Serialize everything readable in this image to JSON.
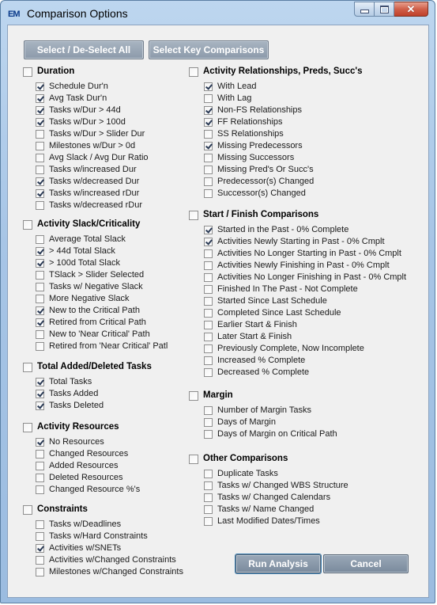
{
  "window": {
    "title": "Comparison Options",
    "icon_text": "EM"
  },
  "top_buttons": {
    "select_all": "Select / De-Select All",
    "select_key": "Select Key Comparisons"
  },
  "bottom_buttons": {
    "run": "Run Analysis",
    "cancel": "Cancel"
  },
  "left_groups": [
    {
      "name": "duration",
      "title": "Duration",
      "checked": false,
      "items": [
        {
          "label": "Schedule Dur'n",
          "checked": true
        },
        {
          "label": "Avg Task Dur'n",
          "checked": true
        },
        {
          "label": "Tasks w/Dur > 44d",
          "checked": true
        },
        {
          "label": "Tasks w/Dur > 100d",
          "checked": true
        },
        {
          "label": "Tasks w/Dur > Slider Dur",
          "checked": false
        },
        {
          "label": "Milestones w/Dur > 0d",
          "checked": false
        },
        {
          "label": "Avg Slack / Avg Dur Ratio",
          "checked": false
        },
        {
          "label": "Tasks w/increased Dur",
          "checked": false
        },
        {
          "label": "Tasks w/decreased Dur",
          "checked": true
        },
        {
          "label": "Tasks w/increased rDur",
          "checked": true
        },
        {
          "label": "Tasks w/decreased rDur",
          "checked": false
        }
      ]
    },
    {
      "name": "activity-slack",
      "title": "Activity Slack/Criticality",
      "checked": false,
      "items": [
        {
          "label": "Average Total Slack",
          "checked": false
        },
        {
          "label": "> 44d Total Slack",
          "checked": true
        },
        {
          "label": "> 100d Total Slack",
          "checked": true
        },
        {
          "label": "TSlack > Slider Selected",
          "checked": false
        },
        {
          "label": "Tasks w/ Negative Slack",
          "checked": false
        },
        {
          "label": "More Negative Slack",
          "checked": false
        },
        {
          "label": "New to the Critical Path",
          "checked": true
        },
        {
          "label": "Retired from Critical Path",
          "checked": true
        },
        {
          "label": "New to 'Near Critical' Path",
          "checked": false
        },
        {
          "label": "Retired from 'Near Critical' Patl",
          "checked": false
        }
      ]
    },
    {
      "name": "total-added-deleted",
      "title": "Total Added/Deleted Tasks",
      "checked": false,
      "items": [
        {
          "label": "Total Tasks",
          "checked": true
        },
        {
          "label": "Tasks Added",
          "checked": true
        },
        {
          "label": "Tasks Deleted",
          "checked": true
        }
      ]
    },
    {
      "name": "activity-resources",
      "title": "Activity Resources",
      "checked": false,
      "items": [
        {
          "label": "No Resources",
          "checked": true
        },
        {
          "label": "Changed Resources",
          "checked": false
        },
        {
          "label": "Added Resources",
          "checked": false
        },
        {
          "label": "Deleted Resources",
          "checked": false
        },
        {
          "label": "Changed Resource %'s",
          "checked": false
        }
      ]
    },
    {
      "name": "constraints",
      "title": "Constraints",
      "checked": false,
      "items": [
        {
          "label": "Tasks w/Deadlines",
          "checked": false
        },
        {
          "label": "Tasks w/Hard Constraints",
          "checked": false
        },
        {
          "label": "Activities w/SNETs",
          "checked": true
        },
        {
          "label": "Activities w/Changed Constraints",
          "checked": false
        },
        {
          "label": "Milestones w/Changed Constraints",
          "checked": false
        }
      ]
    }
  ],
  "right_groups": [
    {
      "name": "relationships",
      "title": "Activity Relationships, Preds, Succ's",
      "checked": false,
      "items": [
        {
          "label": "With Lead",
          "checked": true
        },
        {
          "label": "With Lag",
          "checked": false
        },
        {
          "label": "Non-FS Relationships",
          "checked": true
        },
        {
          "label": "FF Relationships",
          "checked": true
        },
        {
          "label": "SS Relationships",
          "checked": false
        },
        {
          "label": "Missing Predecessors",
          "checked": true
        },
        {
          "label": "Missing Successors",
          "checked": false
        },
        {
          "label": "Missing Pred's Or Succ's",
          "checked": false
        },
        {
          "label": "Predecessor(s) Changed",
          "checked": false
        },
        {
          "label": "Successor(s) Changed",
          "checked": false
        }
      ]
    },
    {
      "name": "start-finish",
      "title": "Start / Finish Comparisons",
      "checked": false,
      "items": [
        {
          "label": "Started in the Past - 0% Complete",
          "checked": true
        },
        {
          "label": "Activities Newly Starting in Past - 0% Cmplt",
          "checked": true
        },
        {
          "label": "Activities No Longer Starting in Past - 0% Cmplt",
          "checked": false
        },
        {
          "label": "Activities Newly Finishing in Past - 0% Cmplt",
          "checked": false
        },
        {
          "label": "Activities No Longer Finishing in Past - 0% Cmplt",
          "checked": false
        },
        {
          "label": "Finished In The Past - Not Complete",
          "checked": false
        },
        {
          "label": "Started Since Last Schedule",
          "checked": false
        },
        {
          "label": "Completed Since Last Schedule",
          "checked": false
        },
        {
          "label": "Earlier Start & Finish",
          "checked": false
        },
        {
          "label": "Later Start & Finish",
          "checked": false
        },
        {
          "label": "Previously Complete, Now Incomplete",
          "checked": false
        },
        {
          "label": "Increased % Complete",
          "checked": false
        },
        {
          "label": "Decreased % Complete",
          "checked": false
        }
      ]
    },
    {
      "name": "margin",
      "title": "Margin",
      "checked": false,
      "items": [
        {
          "label": "Number of Margin Tasks",
          "checked": false
        },
        {
          "label": "Days of Margin",
          "checked": false
        },
        {
          "label": "Days of Margin on Critical Path",
          "checked": false
        }
      ]
    },
    {
      "name": "other",
      "title": "Other Comparisons",
      "checked": false,
      "items": [
        {
          "label": "Duplicate Tasks",
          "checked": false
        },
        {
          "label": "Tasks w/ Changed WBS Structure",
          "checked": false
        },
        {
          "label": "Tasks w/ Changed Calendars",
          "checked": false
        },
        {
          "label": "Tasks w/ Name Changed",
          "checked": false
        },
        {
          "label": "Last Modified Dates/Times",
          "checked": false
        }
      ]
    }
  ]
}
